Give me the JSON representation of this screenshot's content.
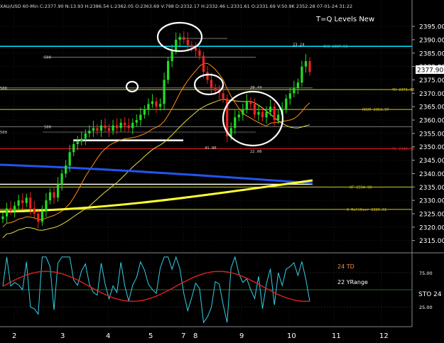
{
  "header": {
    "text": "XAU/USD 60-Min C:2377.90 N:13.93 H:2386.54 L:2362.05 O:2363.69 V:798 D:2332.17 H:2332.46 L:2331.61 O:2331.69 V:50.9K 2352.28 07-01-24 31:22"
  },
  "chart_title": "T=Q Levels New",
  "price_axis": {
    "ticks": [
      2395,
      2390,
      2385,
      2380,
      2375,
      2370,
      2365,
      2360,
      2355,
      2350,
      2345,
      2340,
      2335,
      2330,
      2325,
      2320,
      2315
    ],
    "labels": [
      "2395.00",
      "2390.00",
      "2385.00",
      "2380.00",
      "2375.00",
      "2370.00",
      "2365.00",
      "2360.00",
      "2355.00",
      "2350.00",
      "2345.00",
      "2340.00",
      "2335.00",
      "2330.00",
      "2325.00",
      "2320.00",
      "2315.00"
    ],
    "current_price": "2377.90",
    "ylim": [
      2312,
      2399
    ]
  },
  "time_axis": {
    "labels": [
      "2",
      "3",
      "4",
      "5",
      "6",
      "7",
      "8",
      "9",
      "10",
      "11",
      "12"
    ]
  },
  "level_labels": [
    {
      "text": "0H3 2387.53",
      "price": 2387.53,
      "color": "#2ec4c4"
    },
    {
      "text": "YH 2371.38",
      "price": 2371.38,
      "color": "#d4c31f"
    },
    {
      "text": "ROVR 2363.97",
      "price": 2363.97,
      "color": "#d4c31f"
    },
    {
      "text": "YL 2349.30",
      "price": 2349.3,
      "color": "#c83030"
    },
    {
      "text": "0F 2334.98",
      "price": 2334.98,
      "color": "#d4c31f"
    },
    {
      "text": "0 RollOver 2326.61",
      "price": 2326.61,
      "color": "#d4c31f"
    }
  ],
  "chart_annotations": [
    {
      "text": "500",
      "price": 2383.5
    },
    {
      "text": "500",
      "price": 2372.0
    },
    {
      "text": "500",
      "price": 2357.5
    },
    {
      "text": "500",
      "price": 2355.5
    },
    {
      "text": "20.44",
      "price": 2372.2
    },
    {
      "text": "41.90",
      "price": 2349.6
    },
    {
      "text": "22.06",
      "price": 2348.4
    },
    {
      "text": "23.24",
      "price": 2388.2
    }
  ],
  "oscillator": {
    "labels": {
      "td": "24 TD",
      "yrange": "22 YRange",
      "sto": "STO 24"
    },
    "ticks": [
      "75.00",
      "25.00"
    ],
    "tick_values": [
      75,
      25
    ]
  },
  "colors": {
    "up": "#22dd22",
    "down": "#ee2222",
    "cyan": "#00e5ff",
    "yellow": "#ffff33",
    "blue": "#2255ee",
    "orange": "#ff8c1a",
    "red": "#ff2020",
    "grid": "#3a3a3a"
  },
  "chart_data": {
    "type": "candlestick",
    "instrument": "XAU/USD",
    "interval": "60-Min",
    "ylim": [
      2312,
      2399
    ],
    "x_labels": [
      "2",
      "3",
      "4",
      "5",
      "6",
      "7",
      "8",
      "9",
      "10",
      "11",
      "12"
    ],
    "close_series": [
      2324,
      2327,
      2326,
      2328,
      2330,
      2329,
      2331,
      2327,
      2325,
      2322,
      2326,
      2330,
      2333,
      2331,
      2336,
      2340,
      2343,
      2348,
      2351,
      2352,
      2353,
      2355,
      2356,
      2357,
      2356,
      2358,
      2357,
      2356,
      2358,
      2357,
      2359,
      2358,
      2357,
      2359,
      2360,
      2362,
      2364,
      2366,
      2367,
      2365,
      2366,
      2375,
      2382,
      2386,
      2390,
      2391,
      2390,
      2388,
      2387,
      2386,
      2384,
      2378,
      2375,
      2372,
      2371,
      2370,
      2368,
      2354,
      2357,
      2361,
      2362,
      2364,
      2367,
      2366,
      2362,
      2363,
      2361,
      2363,
      2365,
      2360,
      2362,
      2364,
      2368,
      2370,
      2372,
      2374,
      2380,
      2382,
      2378
    ],
    "horizontal_levels": [
      {
        "price": 2387.53,
        "color": "cyan"
      },
      {
        "price": 2371.38,
        "color": "yellow"
      },
      {
        "price": 2363.97,
        "color": "yellow"
      },
      {
        "price": 2349.3,
        "color": "red"
      },
      {
        "price": 2334.98,
        "color": "yellow"
      },
      {
        "price": 2326.61,
        "color": "yellow"
      },
      {
        "price": 2352.4,
        "color": "white"
      },
      {
        "price": 2336.0,
        "color": "white"
      }
    ],
    "highlight_circles": 4,
    "oscillator_range": [
      0,
      100
    ]
  }
}
